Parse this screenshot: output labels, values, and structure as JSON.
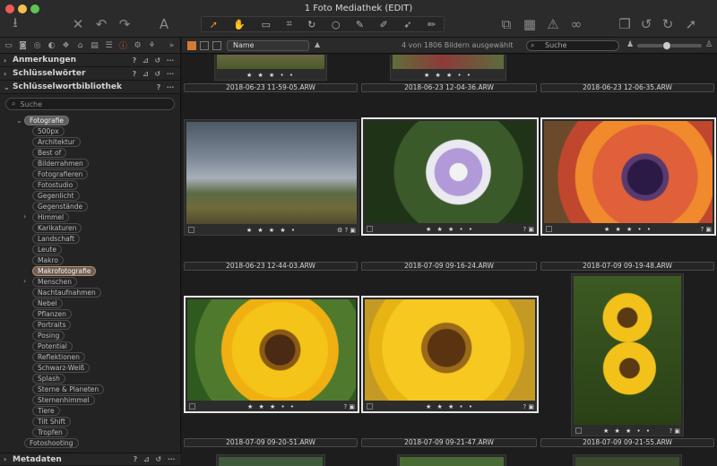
{
  "window": {
    "title": "1 Foto Mediathek (EDIT)"
  },
  "toolbar": {
    "icons": [
      "import-icon",
      "delete-icon",
      "undo-icon",
      "redo-icon",
      "text-icon",
      "cursor-icon",
      "pan-icon",
      "loupe-icon",
      "crop-icon",
      "rotate-icon",
      "circle-icon",
      "brush-icon",
      "picker-icon",
      "arrow-icon",
      "pen-icon",
      "export-icon",
      "grid-icon",
      "warning-icon",
      "glasses-icon",
      "copy-icon",
      "rotate-left-icon",
      "rotate-right-icon",
      "share-icon"
    ]
  },
  "sidebar": {
    "sections": {
      "annotations": "Anmerkungen",
      "keywords": "Schlüsselwörter",
      "library": "Schlüsselwortbibliothek",
      "metadata": "Metadaten"
    },
    "search_placeholder": "Suche",
    "keywords": [
      "Fotografie",
      "500px",
      "Architektur",
      "Best of",
      "Bilderrahmen",
      "Fotografieren",
      "Fotostudio",
      "Gegenlicht",
      "Gegenstände",
      "Himmel",
      "Karikaturen",
      "Landschaft",
      "Leute",
      "Makro",
      "Makrofotografie",
      "Menschen",
      "Nachtaufnahmen",
      "Nebel",
      "Pflanzen",
      "Portraits",
      "Posing",
      "Potential",
      "Reflektionen",
      "Schwarz-Weiß",
      "Splash",
      "Sterne & Planeten",
      "Sternenhimmel",
      "Tiere",
      "Tilt Shift",
      "Tropfen",
      "Fotoshooting"
    ]
  },
  "browser": {
    "sort_label": "Name",
    "count_text": "4 von 1806 Bildern ausgewählt",
    "search_placeholder": "Suche",
    "size_slider_value": 0.45,
    "rows": [
      {
        "files": [
          "2018-06-23 11-59-05.ARW",
          "2018-06-23 12-04-36.ARW",
          "2018-06-23 12-06-35.ARW"
        ]
      },
      {
        "files": [
          "2018-06-23 12-44-03.ARW",
          "2018-07-09 09-16-24.ARW",
          "2018-07-09 09-19-48.ARW"
        ]
      },
      {
        "files": [
          "2018-07-09 09-20-51.ARW",
          "2018-07-09 09-21-47.ARW",
          "2018-07-09 09-21-55.ARW"
        ]
      }
    ],
    "stars_text": "★ ★ ★ • •",
    "stars_text_full": "★ ★ ★ ★ •"
  },
  "colors": {
    "accent": "#d37a35",
    "highlight_keyword": "#6e5e55",
    "background": "#1d1d1d"
  }
}
